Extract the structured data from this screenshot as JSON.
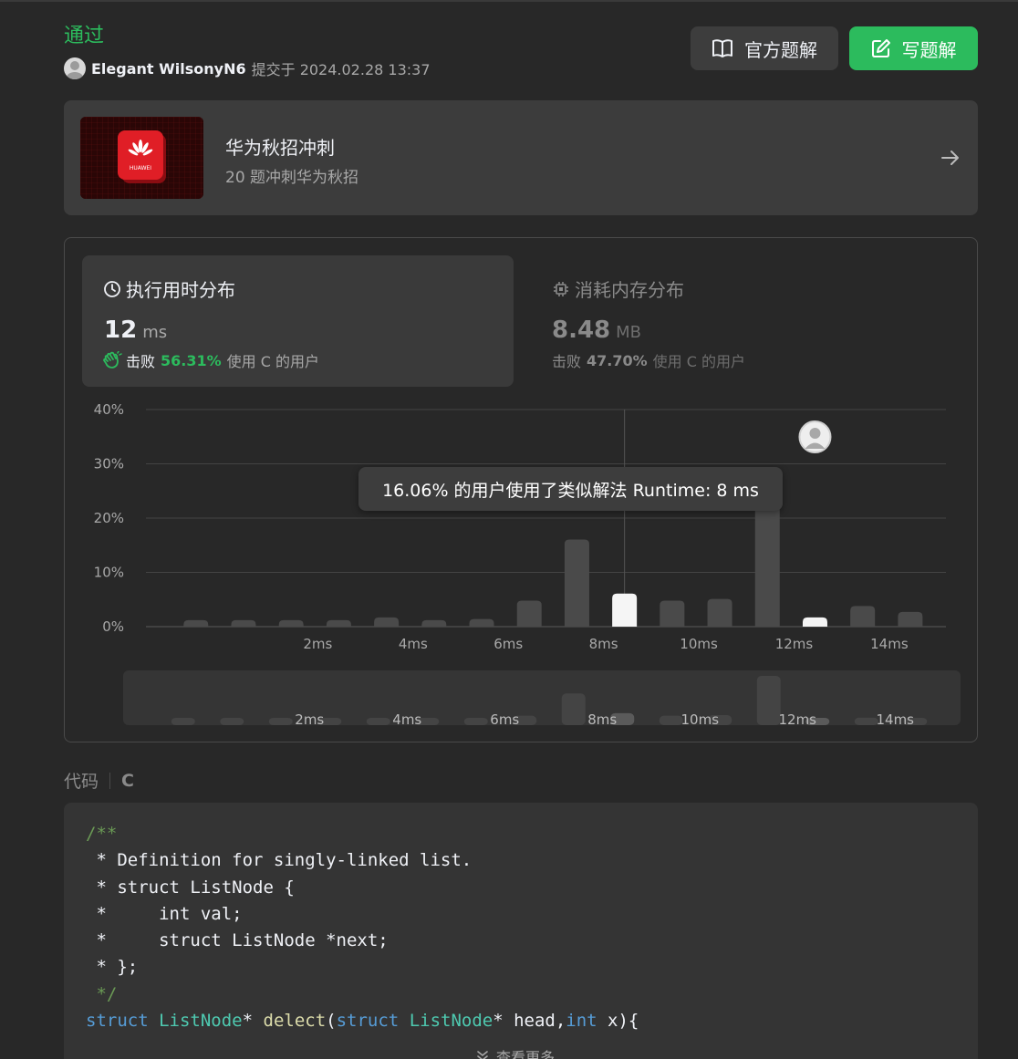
{
  "header": {
    "status": "通过",
    "username": "Elegant WilsonyN6",
    "submitted": "提交于 2024.02.28 13:37",
    "official_solution_label": "官方题解",
    "write_solution_label": "写题解"
  },
  "banner": {
    "title": "华为秋招冲刺",
    "description": "20 题冲刺华为秋招",
    "logo_text": "HUAWEI"
  },
  "runtime": {
    "title": "执行用时分布",
    "value": "12",
    "unit": "ms",
    "beat_word": "击败",
    "beat_pct": "56.31%",
    "beat_suffix": "使用 C 的用户"
  },
  "memory": {
    "title": "消耗内存分布",
    "value": "8.48",
    "unit": "MB",
    "beat_word": "击败",
    "beat_pct": "47.70%",
    "beat_suffix": "使用 C 的用户"
  },
  "tooltip": "16.06% 的用户使用了类似解法 Runtime: 8 ms",
  "chart_data": {
    "type": "bar",
    "y_ticks": [
      "40%",
      "30%",
      "20%",
      "10%",
      "0%"
    ],
    "ylim": [
      0,
      40
    ],
    "x_tick_labels": [
      "2ms",
      "4ms",
      "6ms",
      "8ms",
      "10ms",
      "12ms",
      "14ms"
    ],
    "x_tick_positions": [
      2,
      4,
      6,
      8,
      10,
      12,
      14
    ],
    "x": [
      -0.5,
      0.5,
      1.5,
      2.5,
      3.5,
      4.5,
      5.5,
      6.5,
      7.5,
      8.5,
      9.5,
      10.5,
      11.5,
      12.5,
      13.5,
      14.5
    ],
    "values": [
      1.2,
      1.2,
      1.2,
      1.2,
      1.7,
      1.2,
      1.4,
      4.8,
      16.06,
      6.1,
      4.8,
      5.1,
      25.0,
      1.7,
      3.8,
      2.7
    ],
    "highlighted": [
      8.5,
      12.5
    ],
    "current_runtime_ms": 12,
    "grid": true
  },
  "code": {
    "label": "代码",
    "language": "C",
    "show_more": "查看更多",
    "lines": [
      "/**",
      " * Definition for singly-linked list.",
      " * struct ListNode {",
      " *     int val;",
      " *     struct ListNode *next;",
      " * };",
      " */",
      "struct ListNode* delect(struct ListNode* head,int x){"
    ]
  },
  "colors": {
    "accent": "#2cbb5d",
    "bar_default": "#4a4a4a",
    "bar_highlight": "#f5f5f5"
  }
}
